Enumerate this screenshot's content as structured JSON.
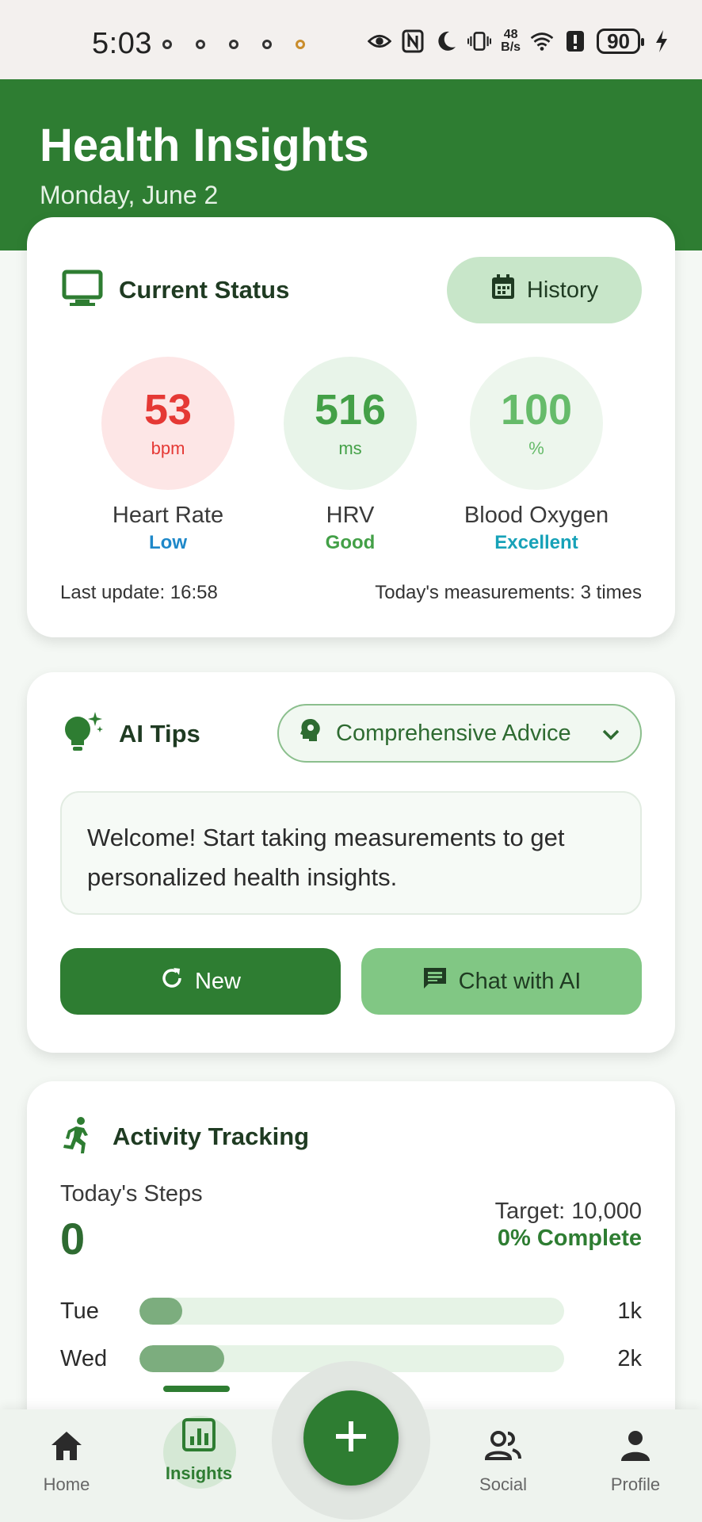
{
  "status_bar": {
    "time": "5:03",
    "net_speed_top": "48",
    "net_speed_bottom": "B/s",
    "battery": "90"
  },
  "header": {
    "title": "Health Insights",
    "date": "Monday, June 2"
  },
  "current_status": {
    "title": "Current Status",
    "history_label": "History",
    "metrics": [
      {
        "value": "53",
        "unit": "bpm",
        "label": "Heart Rate",
        "status": "Low"
      },
      {
        "value": "516",
        "unit": "ms",
        "label": "HRV",
        "status": "Good"
      },
      {
        "value": "100",
        "unit": "%",
        "label": "Blood Oxygen",
        "status": "Excellent"
      }
    ],
    "last_update": "Last update: 16:58",
    "measurements": "Today's measurements: 3 times"
  },
  "ai_tips": {
    "title": "AI Tips",
    "advice_selected": "Comprehensive Advice",
    "message": "Welcome! Start taking measurements to get personalized health insights.",
    "new_label": "New",
    "chat_label": "Chat with AI"
  },
  "activity": {
    "title": "Activity Tracking",
    "steps_label": "Today's Steps",
    "steps_value": "0",
    "target": "Target: 10,000",
    "complete": "0% Complete",
    "bars": [
      {
        "day": "Tue",
        "amount": "1k",
        "fraction": 0.1
      },
      {
        "day": "Wed",
        "amount": "2k",
        "fraction": 0.2
      }
    ]
  },
  "nav": {
    "home": "Home",
    "insights": "Insights",
    "social": "Social",
    "profile": "Profile"
  },
  "colors": {
    "primary": "#2e7d32",
    "heart": "#e53935",
    "hrv": "#43a047",
    "oxygen": "#66bb6a",
    "status_low": "#1e88c9",
    "status_good": "#43a047",
    "status_excellent": "#17a2b8"
  }
}
